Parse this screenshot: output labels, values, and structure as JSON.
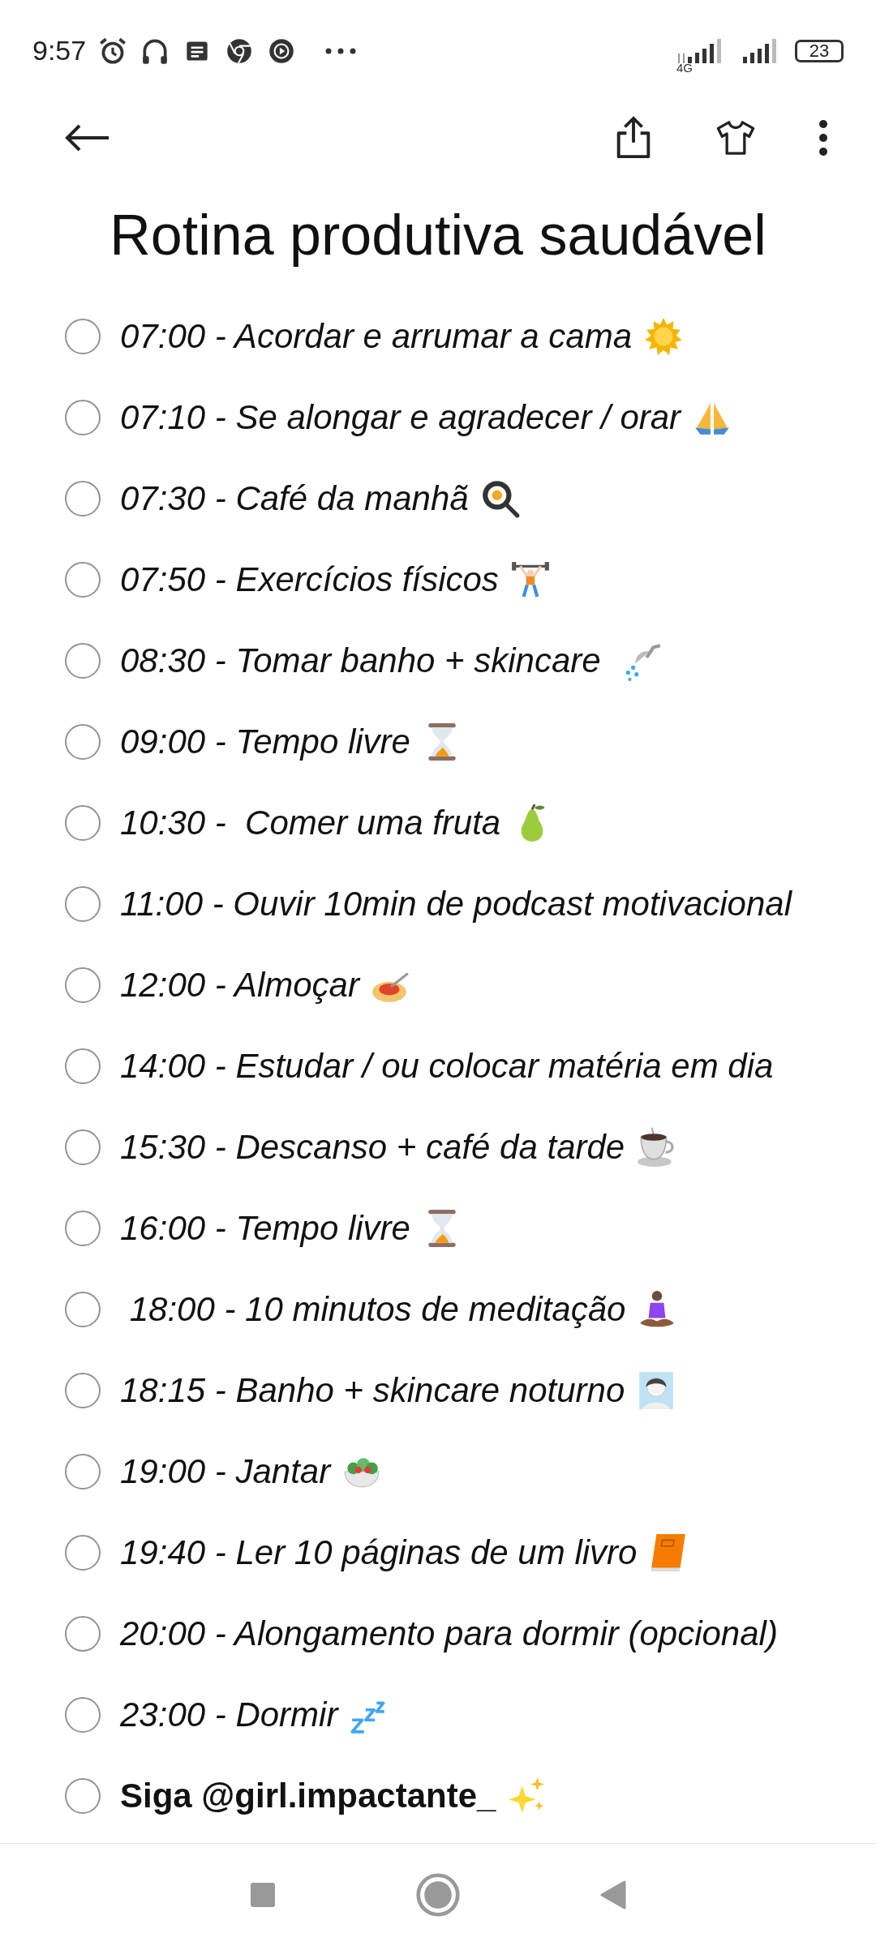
{
  "status_bar": {
    "time": "9:57",
    "network": "4G",
    "battery": "23"
  },
  "title": "Rotina produtiva saudável",
  "items": [
    {
      "kind": "task",
      "text": "07:00 - Acordar e arrumar a cama",
      "checked": false
    },
    {
      "kind": "task",
      "text": "07:10 - Se alongar e agradecer / orar",
      "checked": false
    },
    {
      "kind": "task",
      "text": "07:30 - Café da manhã",
      "checked": false
    },
    {
      "kind": "task",
      "text": "07:50 - Exercícios físicos",
      "checked": false
    },
    {
      "kind": "task",
      "text": "08:30 - Tomar banho + skincare ",
      "checked": false
    },
    {
      "kind": "task",
      "text": "09:00 - Tempo livre",
      "checked": false
    },
    {
      "kind": "task",
      "text": "10:30 -  Comer uma fruta",
      "checked": false
    },
    {
      "kind": "task",
      "text": "11:00 - Ouvir 10min de podcast motivacional",
      "checked": false
    },
    {
      "kind": "task",
      "text": "12:00 - Almoçar",
      "checked": false
    },
    {
      "kind": "task",
      "text": "14:00 - Estudar / ou colocar matéria em dia",
      "checked": false
    },
    {
      "kind": "task",
      "text": "15:30 - Descanso + café da tarde",
      "checked": false
    },
    {
      "kind": "task",
      "text": "16:00 - Tempo livre",
      "checked": false
    },
    {
      "kind": "task",
      "text": " 18:00 - 10 minutos de meditação",
      "checked": false
    },
    {
      "kind": "task",
      "text": "18:15 - Banho + skincare noturno",
      "checked": false
    },
    {
      "kind": "task",
      "text": "19:00 - Jantar",
      "checked": false
    },
    {
      "kind": "task",
      "text": "19:40 - Ler 10 páginas de um livro",
      "checked": false
    },
    {
      "kind": "task",
      "text": "20:00 - Alongamento para dormir (opcional)",
      "checked": false
    },
    {
      "kind": "task",
      "text": "23:00 - Dormir",
      "checked": false
    },
    {
      "kind": "highlight",
      "text": "Siga @girl.impactante_",
      "checked": false
    }
  ]
}
